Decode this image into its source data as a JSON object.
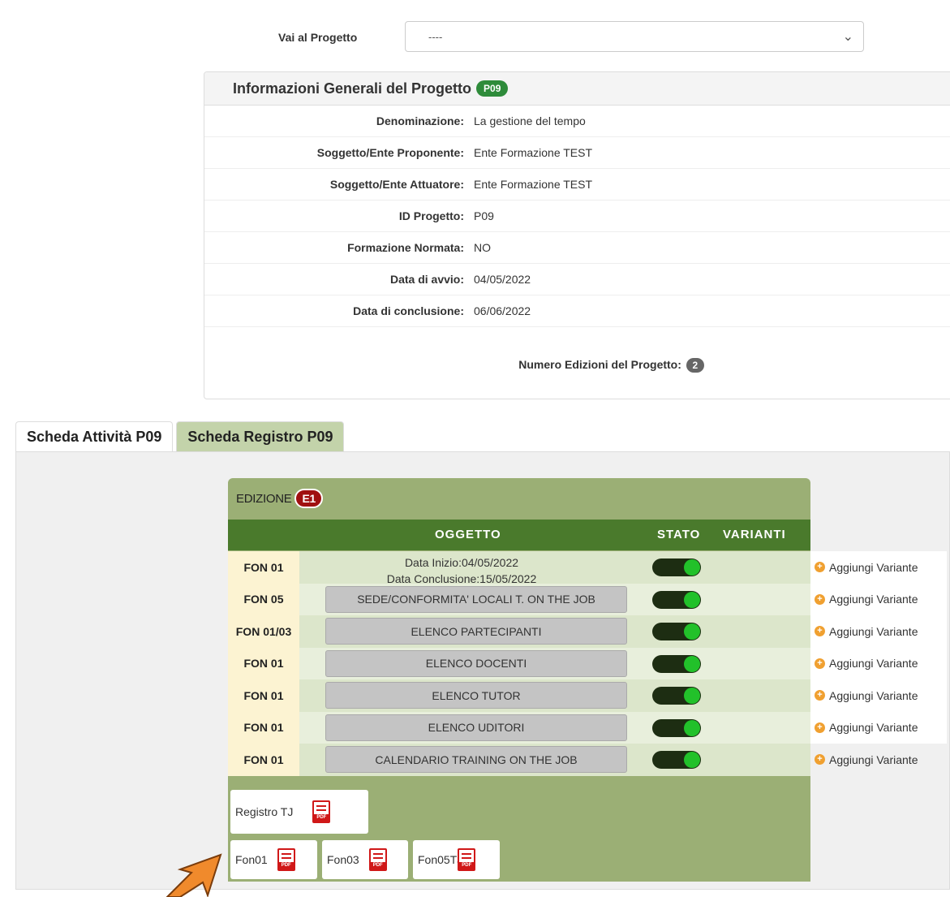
{
  "goto": {
    "label": "Vai al Progetto",
    "selected": "----"
  },
  "info": {
    "title": "Informazioni Generali del Progetto",
    "code_badge": "P09",
    "rows": [
      {
        "label": "Denominazione:",
        "value": "La gestione del tempo"
      },
      {
        "label": "Soggetto/Ente Proponente:",
        "value": "Ente Formazione TEST"
      },
      {
        "label": "Soggetto/Ente Attuatore:",
        "value": "Ente Formazione TEST"
      },
      {
        "label": "ID Progetto:",
        "value": "P09"
      },
      {
        "label": "Formazione Normata:",
        "value": "NO"
      },
      {
        "label": "Data di avvio:",
        "value": "04/05/2022"
      },
      {
        "label": "Data di conclusione:",
        "value": "06/06/2022"
      }
    ],
    "editions_label": "Numero Edizioni del Progetto:",
    "editions_count": "2"
  },
  "tabs": [
    {
      "label": "Scheda Attività P09",
      "active": true
    },
    {
      "label": "Scheda Registro P09",
      "active": false
    }
  ],
  "edition": {
    "label": "EDIZIONE",
    "badge": "E1",
    "columns": {
      "oggetto": "OGGETTO",
      "stato": "STATO",
      "varianti": "VARIANTI"
    },
    "rows": [
      {
        "code": "FON 01",
        "date_start": "Data Inizio:04/05/2022",
        "date_end": "Data Conclusione:15/05/2022",
        "variant": "Aggiungi Variante"
      },
      {
        "code": "FON 05",
        "object": "SEDE/CONFORMITA' LOCALI T. ON THE JOB",
        "variant": "Aggiungi Variante"
      },
      {
        "code": "FON 01/03",
        "object": "ELENCO PARTECIPANTI",
        "variant": "Aggiungi Variante"
      },
      {
        "code": "FON 01",
        "object": "ELENCO DOCENTI",
        "variant": "Aggiungi Variante"
      },
      {
        "code": "FON 01",
        "object": "ELENCO TUTOR",
        "variant": "Aggiungi Variante"
      },
      {
        "code": "FON 01",
        "object": "ELENCO UDITORI",
        "variant": "Aggiungi Variante"
      },
      {
        "code": "FON 01",
        "object": "CALENDARIO TRAINING ON THE JOB",
        "variant": "Aggiungi Variante"
      }
    ],
    "pdf_label": "PDF",
    "docs": {
      "registro": "Registro TJ",
      "fon01": "Fon01",
      "fon03": "Fon03",
      "fon05": "Fon05TJ"
    }
  }
}
